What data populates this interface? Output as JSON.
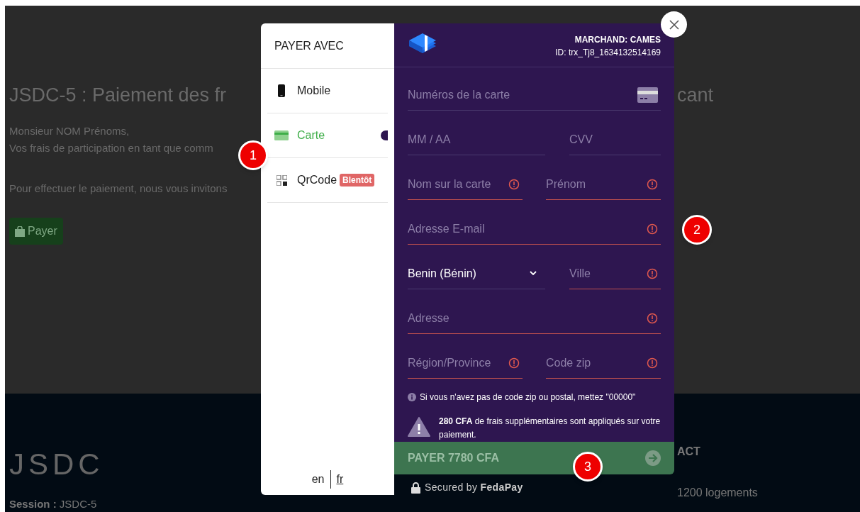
{
  "page": {
    "heading_start": "JSDC-5 : Paiement des fr",
    "heading_end": "cant",
    "greeting": "Monsieur NOM Prénoms,",
    "line": "Vos frais de participation en tant que comm",
    "instruction": "Pour effectuer le paiement, nous vous invitons",
    "pay_button": "Payer"
  },
  "footer": {
    "brand": "JSDC",
    "session": "**Session :** JSDC-5",
    "contact_heading": "ACT",
    "contact_line": "1200 logements"
  },
  "modal": {
    "sidebar": {
      "title": "PAYER AVEC",
      "methods": [
        {
          "kind": "mobile",
          "label": "Mobile",
          "selected": false
        },
        {
          "kind": "card",
          "label": "Carte",
          "selected": true
        },
        {
          "kind": "qr",
          "label": "QrCode",
          "selected": false,
          "badge": "Blentôt"
        }
      ],
      "languages": [
        {
          "label": "en",
          "selected": false
        },
        {
          "label": "fr",
          "selected": true
        }
      ]
    },
    "merchant": "MARCHAND: CAMES",
    "transaction_id": "ID: trx_Tj8_1634132514169",
    "rows": [
      [
        {
          "kind": "input",
          "placeholder": "Numéros de la carte",
          "error": false,
          "card_icon": true
        }
      ],
      [
        {
          "kind": "input",
          "placeholder": "MM / AA",
          "error": false
        },
        {
          "kind": "input",
          "placeholder": "CVV",
          "error": false
        }
      ],
      [
        {
          "kind": "input",
          "placeholder": "Nom sur la carte",
          "error": true
        },
        {
          "kind": "input",
          "placeholder": "Prénom",
          "error": true
        }
      ],
      [
        {
          "kind": "input",
          "placeholder": "Adresse E-mail",
          "error": true
        }
      ],
      [
        {
          "kind": "select",
          "value": "Benin (Bénin)",
          "error": false
        },
        {
          "kind": "input",
          "placeholder": "Ville",
          "error": true
        }
      ],
      [
        {
          "kind": "input",
          "placeholder": "Adresse",
          "error": true
        }
      ],
      [
        {
          "kind": "input",
          "placeholder": "Région/Province",
          "error": true
        },
        {
          "kind": "input",
          "placeholder": "Code zip",
          "error": true
        }
      ]
    ],
    "zip_note": "Si vous n'avez pas de code zip ou postal, mettez \"00000\"",
    "fee_note": "**280 CFA** de frais supplémentaires sont appliqués sur votre paiement.",
    "pay_button": "PAYER 7780 CFA",
    "secured": "Secured by **FedaPay**"
  },
  "annotations": [
    "1",
    "2",
    "3"
  ]
}
